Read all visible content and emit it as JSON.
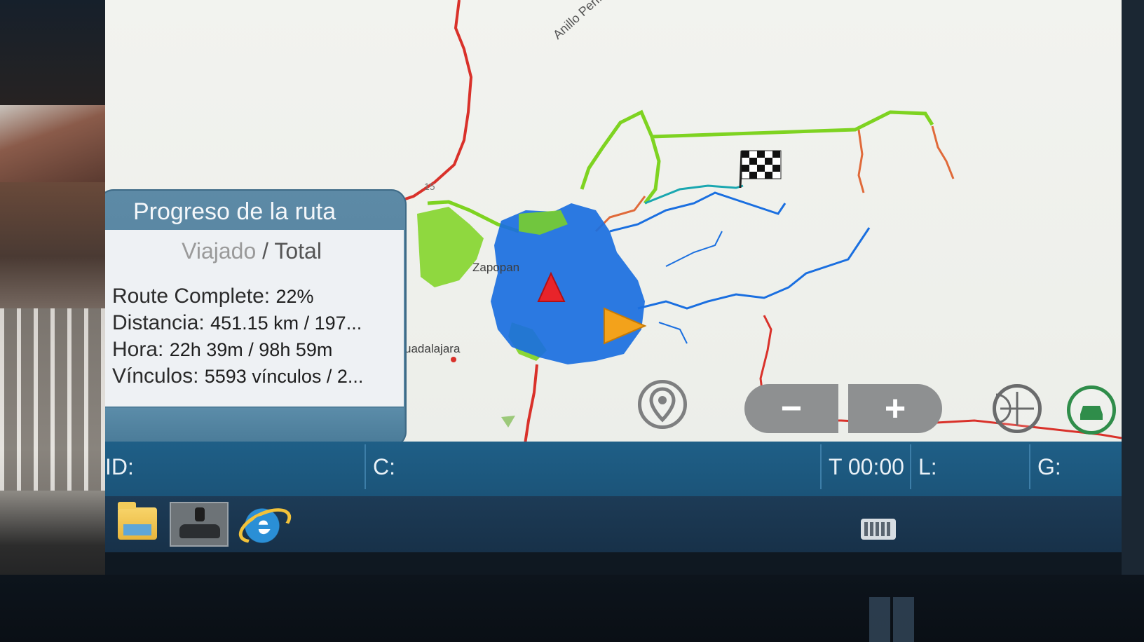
{
  "map": {
    "road_label": "Anillo Periférico Pon",
    "road_number": "15",
    "city_label_zapopan": "Zapopan",
    "city_label_guadalajara": "uadalajara",
    "colors": {
      "background": "#eeefeb",
      "road_red": "#d9312a",
      "traveled_green": "#7ed321",
      "pending_blue": "#1a6fe0",
      "road_orange": "#e06a3a"
    }
  },
  "progress_panel": {
    "title": "Progreso de la ruta",
    "subtitle_traveled": "Viajado",
    "subtitle_sep": " / ",
    "subtitle_total": "Total",
    "route_complete_label": "Route Complete:",
    "route_complete_value": "22%",
    "distance_label": "Distancia:",
    "distance_value": "451.15 km / 197...",
    "time_label": "Hora:",
    "time_value": "22h 39m / 98h 59m",
    "links_label": "Vínculos:",
    "links_value": "5593 vínculos / 2..."
  },
  "map_controls": {
    "location_pin": "location-pin-icon",
    "zoom_out_label": "−",
    "zoom_in_label": "+",
    "center_icon": "crosshair-icon",
    "vehicle_icon": "car-icon"
  },
  "status_bar": {
    "id_label": "ID:",
    "c_label": "C:",
    "t_value": "T 00:00",
    "l_label": "L:",
    "g_label": "G:"
  },
  "taskbar": {
    "icons": [
      "folder-icon",
      "car-camera-app-icon",
      "internet-explorer-icon",
      "keyboard-icon"
    ]
  }
}
